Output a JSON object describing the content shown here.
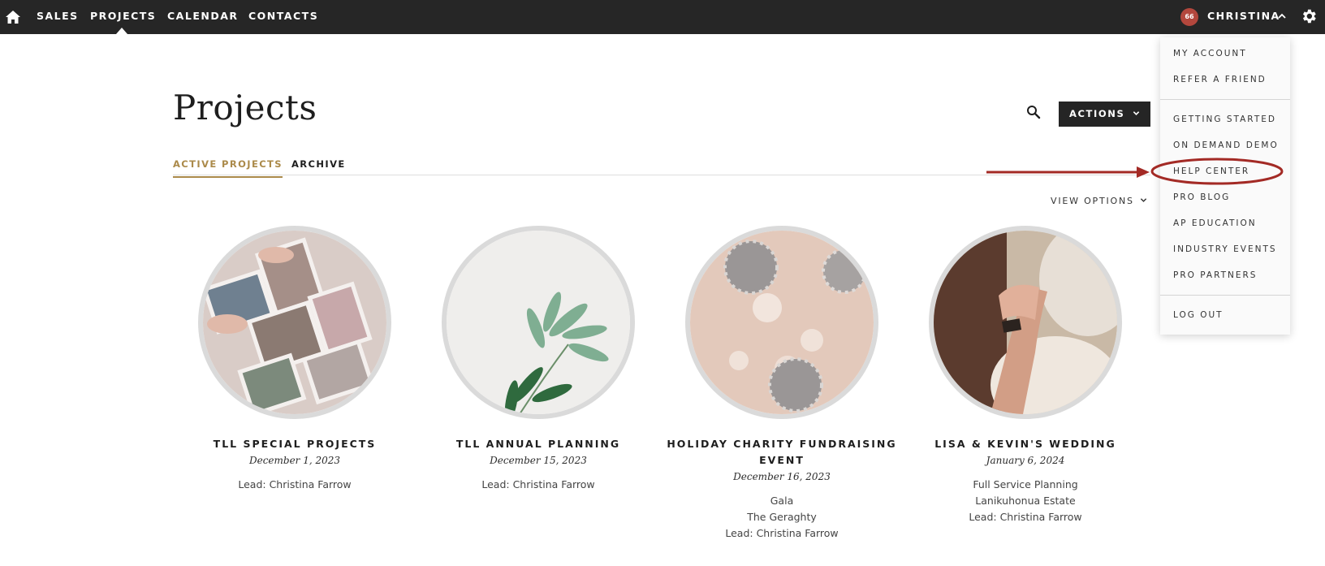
{
  "nav": {
    "items": [
      "SALES",
      "PROJECTS",
      "CALENDAR",
      "CONTACTS"
    ],
    "active": "PROJECTS",
    "user": {
      "initials": "66",
      "name": "CHRISTINA"
    }
  },
  "page": {
    "title": "Projects",
    "actions_label": "ACTIONS",
    "tabs": [
      "ACTIVE PROJECTS",
      "ARCHIVE"
    ],
    "view_options_label": "VIEW OPTIONS"
  },
  "projects": [
    {
      "title_lines": [
        "TLL SPECIAL PROJECTS"
      ],
      "date": "December 1, 2023",
      "details": [
        "Lead: Christina Farrow"
      ]
    },
    {
      "title_lines": [
        "TLL ANNUAL PLANNING"
      ],
      "date": "December 15, 2023",
      "details": [
        "Lead: Christina Farrow"
      ]
    },
    {
      "title_lines": [
        "HOLIDAY CHARITY FUNDRAISING",
        "EVENT"
      ],
      "date": "December 16, 2023",
      "details": [
        "Gala",
        "The Geraghty",
        "Lead: Christina Farrow"
      ]
    },
    {
      "title_lines": [
        "LISA & KEVIN'S WEDDING"
      ],
      "date": "January 6, 2024",
      "details": [
        "Full Service Planning",
        "Lanikuhonua Estate",
        "Lead: Christina Farrow"
      ]
    }
  ],
  "dropdown": {
    "items": [
      "MY ACCOUNT",
      "REFER A FRIEND",
      "GETTING STARTED",
      "ON DEMAND DEMO",
      "HELP CENTER",
      "PRO BLOG",
      "AP EDUCATION",
      "INDUSTRY EVENTS",
      "PRO PARTNERS",
      "LOG OUT"
    ],
    "highlighted": "HELP CENTER"
  },
  "colors": {
    "topbar": "#262626",
    "accent": "#ab8a4a",
    "annotation": "#a32a25",
    "avatar": "#b3473d"
  }
}
